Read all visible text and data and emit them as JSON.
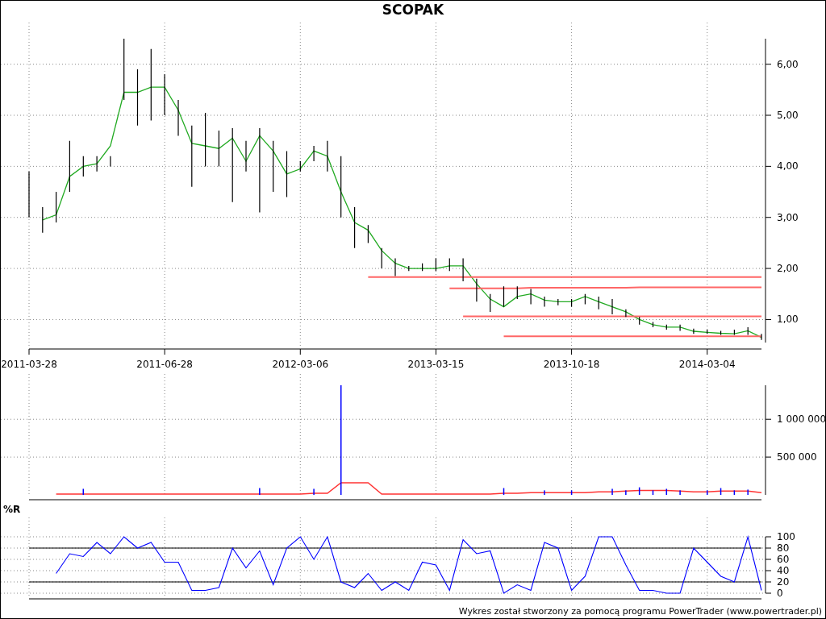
{
  "title": "SCOPAK",
  "price_panel": {
    "chart_data": {
      "type": "line",
      "grid": true,
      "categories": [
        "2011-03-28",
        null,
        null,
        null,
        null,
        null,
        null,
        null,
        null,
        null,
        "2011-06-28",
        null,
        null,
        null,
        null,
        null,
        null,
        null,
        null,
        null,
        "2012-03-06",
        null,
        null,
        null,
        null,
        null,
        null,
        null,
        null,
        null,
        "2013-03-15",
        null,
        null,
        null,
        null,
        null,
        null,
        null,
        null,
        null,
        "2013-10-18",
        null,
        null,
        null,
        null,
        null,
        null,
        null,
        null,
        null,
        "2014-03-04",
        null,
        null,
        null,
        null
      ],
      "ylim": [
        0.47,
        6.5
      ],
      "yticks": [
        {
          "value": 1,
          "label": "1,00"
        },
        {
          "value": 2,
          "label": "2,00"
        },
        {
          "value": 3,
          "label": "3,00"
        },
        {
          "value": 4,
          "label": "4,00"
        },
        {
          "value": 5,
          "label": "5,00"
        },
        {
          "value": 6,
          "label": "6,00"
        }
      ],
      "series": [
        {
          "color": "#22aa22",
          "values": [
            null,
            2.95,
            3.05,
            3.8,
            4.0,
            4.05,
            4.4,
            5.45,
            5.45,
            5.55,
            5.55,
            5.1,
            4.45,
            4.4,
            4.35,
            4.55,
            4.1,
            4.6,
            4.3,
            3.85,
            3.95,
            4.3,
            4.2,
            3.5,
            2.9,
            2.75,
            2.35,
            2.1,
            2.0,
            2.0,
            2.0,
            2.05,
            2.05,
            1.7,
            1.4,
            1.25,
            1.45,
            1.5,
            1.38,
            1.35,
            1.35,
            1.45,
            1.35,
            1.25,
            1.15,
            1.0,
            0.9,
            0.85,
            0.85,
            0.77,
            0.75,
            0.73,
            0.72,
            0.78,
            0.65
          ]
        },
        {
          "color": "#ff6666",
          "values": [
            null,
            null,
            null,
            null,
            null,
            null,
            null,
            null,
            null,
            null,
            null,
            null,
            null,
            null,
            null,
            null,
            null,
            null,
            null,
            null,
            null,
            null,
            null,
            null,
            null,
            1.83,
            1.83,
            1.83,
            1.83,
            1.83,
            1.83,
            1.83,
            1.83,
            1.83,
            1.83,
            1.83,
            1.83,
            1.83,
            1.83,
            1.83,
            1.83,
            1.83,
            1.83,
            1.83,
            1.83,
            1.83,
            1.83,
            1.83,
            1.83,
            1.83,
            1.83,
            1.83,
            1.83,
            1.83,
            1.83
          ]
        },
        {
          "color": "#ff6666",
          "values": [
            null,
            null,
            null,
            null,
            null,
            null,
            null,
            null,
            null,
            null,
            null,
            null,
            null,
            null,
            null,
            null,
            null,
            null,
            null,
            null,
            null,
            null,
            null,
            null,
            null,
            null,
            null,
            null,
            null,
            null,
            null,
            1.61,
            1.61,
            1.61,
            1.61,
            1.61,
            1.61,
            1.62,
            1.62,
            1.62,
            1.62,
            1.62,
            1.62,
            1.62,
            1.62,
            1.63,
            1.63,
            1.63,
            1.63,
            1.63,
            1.63,
            1.63,
            1.63,
            1.63,
            1.63
          ]
        },
        {
          "color": "#ff6666",
          "values": [
            null,
            null,
            null,
            null,
            null,
            null,
            null,
            null,
            null,
            null,
            null,
            null,
            null,
            null,
            null,
            null,
            null,
            null,
            null,
            null,
            null,
            null,
            null,
            null,
            null,
            null,
            null,
            null,
            null,
            null,
            null,
            null,
            1.06,
            1.06,
            1.06,
            1.06,
            1.06,
            1.06,
            1.06,
            1.06,
            1.06,
            1.06,
            1.06,
            1.06,
            1.06,
            1.06,
            1.06,
            1.06,
            1.06,
            1.06,
            1.06,
            1.06,
            1.06,
            1.06,
            1.06
          ]
        },
        {
          "color": "#ff6666",
          "values": [
            null,
            null,
            null,
            null,
            null,
            null,
            null,
            null,
            null,
            null,
            null,
            null,
            null,
            null,
            null,
            null,
            null,
            null,
            null,
            null,
            null,
            null,
            null,
            null,
            null,
            null,
            null,
            null,
            null,
            null,
            null,
            null,
            null,
            null,
            null,
            0.67,
            0.67,
            0.67,
            0.67,
            0.67,
            0.67,
            0.67,
            0.67,
            0.67,
            0.67,
            0.67,
            0.67,
            0.67,
            0.67,
            0.67,
            0.67,
            0.67,
            0.67,
            0.67,
            0.67
          ]
        }
      ]
    }
  },
  "volume_panel": {
    "chart_data": {
      "type": "bar",
      "grid": true,
      "categories": [
        null,
        null,
        null,
        null,
        null,
        null,
        null,
        null,
        null,
        null,
        null,
        null,
        null,
        null,
        null,
        null,
        null,
        null,
        null,
        null,
        null,
        null,
        null,
        null,
        null,
        null,
        null,
        null,
        null,
        null,
        null,
        null,
        null,
        null,
        null,
        null,
        null,
        null,
        null,
        null,
        null,
        null,
        null,
        null,
        null,
        null,
        null,
        null,
        null,
        null,
        null,
        null,
        null,
        null,
        null
      ],
      "ylim": [
        0,
        1450000
      ],
      "yticks": [
        {
          "value": 500000,
          "label": "500 000"
        },
        {
          "value": 1000000,
          "label": "1 000 000"
        }
      ],
      "series": [
        {
          "color": "#0000ff",
          "values": [
            null,
            null,
            null,
            null,
            80000,
            null,
            null,
            null,
            null,
            null,
            null,
            null,
            null,
            null,
            null,
            null,
            null,
            90000,
            null,
            null,
            null,
            80000,
            null,
            1450000,
            null,
            null,
            null,
            null,
            null,
            null,
            null,
            null,
            null,
            null,
            null,
            90000,
            null,
            null,
            60000,
            null,
            60000,
            null,
            null,
            80000,
            60000,
            100000,
            60000,
            80000,
            60000,
            null,
            60000,
            90000,
            60000,
            70000,
            null
          ]
        },
        {
          "type": "line",
          "color": "#ff3333",
          "values": [
            null,
            null,
            10000,
            10000,
            10000,
            10000,
            10000,
            10000,
            10000,
            10000,
            10000,
            10000,
            10000,
            10000,
            10000,
            10000,
            10000,
            10000,
            10000,
            10000,
            10000,
            20000,
            20000,
            160000,
            160000,
            160000,
            10000,
            10000,
            10000,
            10000,
            10000,
            10000,
            10000,
            10000,
            10000,
            20000,
            20000,
            30000,
            30000,
            30000,
            30000,
            30000,
            40000,
            40000,
            50000,
            60000,
            60000,
            60000,
            50000,
            40000,
            40000,
            50000,
            50000,
            50000,
            30000
          ]
        }
      ]
    }
  },
  "williams_panel": {
    "chart_data": {
      "type": "line",
      "grid": true,
      "title": "%R",
      "categories": [
        null,
        null,
        null,
        null,
        null,
        null,
        null,
        null,
        null,
        null,
        null,
        null,
        null,
        null,
        null,
        null,
        null,
        null,
        null,
        null,
        null,
        null,
        null,
        null,
        null,
        null,
        null,
        null,
        null,
        null,
        null,
        null,
        null,
        null,
        null,
        null,
        null,
        null,
        null,
        null,
        null,
        null,
        null,
        null,
        null,
        null,
        null,
        null,
        null,
        null,
        null,
        null,
        null,
        null,
        null
      ],
      "ylim": [
        0,
        100
      ],
      "yticks": [
        {
          "value": 0,
          "label": "0"
        },
        {
          "value": 20,
          "label": "20"
        },
        {
          "value": 40,
          "label": "40"
        },
        {
          "value": 60,
          "label": "60"
        },
        {
          "value": 80,
          "label": "80"
        },
        {
          "value": 100,
          "label": "100"
        }
      ],
      "series": [
        {
          "color": "#000000",
          "values": [
            80,
            80,
            80,
            80,
            80,
            80,
            80,
            80,
            80,
            80,
            80,
            80,
            80,
            80,
            80,
            80,
            80,
            80,
            80,
            80,
            80,
            80,
            80,
            80,
            80,
            80,
            80,
            80,
            80,
            80,
            80,
            80,
            80,
            80,
            80,
            80,
            80,
            80,
            80,
            80,
            80,
            80,
            80,
            80,
            80,
            80,
            80,
            80,
            80,
            80,
            80,
            80,
            80,
            80,
            80
          ]
        },
        {
          "color": "#000000",
          "values": [
            20,
            20,
            20,
            20,
            20,
            20,
            20,
            20,
            20,
            20,
            20,
            20,
            20,
            20,
            20,
            20,
            20,
            20,
            20,
            20,
            20,
            20,
            20,
            20,
            20,
            20,
            20,
            20,
            20,
            20,
            20,
            20,
            20,
            20,
            20,
            20,
            20,
            20,
            20,
            20,
            20,
            20,
            20,
            20,
            20,
            20,
            20,
            20,
            20,
            20,
            20,
            20,
            20,
            20,
            20
          ]
        },
        {
          "color": "#0000ff",
          "values": [
            null,
            null,
            35,
            70,
            65,
            90,
            70,
            100,
            80,
            90,
            55,
            55,
            5,
            5,
            10,
            80,
            45,
            75,
            15,
            80,
            100,
            60,
            100,
            20,
            10,
            35,
            5,
            20,
            5,
            55,
            50,
            5,
            95,
            70,
            75,
            0,
            15,
            5,
            90,
            80,
            5,
            30,
            100,
            100,
            50,
            5,
            5,
            0,
            0,
            80,
            55,
            30,
            20,
            100,
            5
          ]
        }
      ]
    }
  },
  "footer": "Wykres został stworzony za pomocą programu PowerTrader (www.powertrader.pl)"
}
